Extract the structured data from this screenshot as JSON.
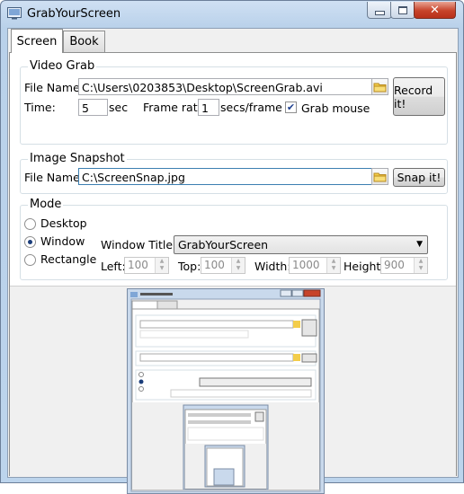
{
  "window": {
    "title": "GrabYourScreen"
  },
  "tabs": [
    {
      "label": "Screen"
    },
    {
      "label": "Book"
    }
  ],
  "video_grab": {
    "group_label": "Video Grab",
    "file_name_label": "File Name:",
    "file_name_value": "C:\\Users\\0203853\\Desktop\\ScreenGrab.avi",
    "time_label": "Time:",
    "time_value": "5",
    "time_unit": "sec",
    "frame_rate_label": "Frame rate:",
    "frame_rate_value": "1",
    "frame_rate_unit": "secs/frame",
    "grab_mouse_label": "Grab mouse",
    "grab_mouse_checked": true,
    "record_button": "Record it!"
  },
  "image_snapshot": {
    "group_label": "Image Snapshot",
    "file_name_label": "File Name:",
    "file_name_value": "C:\\ScreenSnap.jpg",
    "snap_button": "Snap it!"
  },
  "mode": {
    "group_label": "Mode",
    "options": [
      {
        "label": "Desktop",
        "selected": false
      },
      {
        "label": "Window",
        "selected": true
      },
      {
        "label": "Rectangle",
        "selected": false
      }
    ],
    "window_title_label": "Window Title:",
    "window_title_value": "GrabYourScreen",
    "left_label": "Left:",
    "left_value": "100",
    "top_label": "Top:",
    "top_value": "100",
    "width_label": "Width:",
    "width_value": "1000",
    "height_label": "Height:",
    "height_value": "900"
  },
  "colors": {
    "title_bar": "#b9d1ea",
    "close_button": "#c7432a",
    "panel_background": "#f0f0f0"
  }
}
